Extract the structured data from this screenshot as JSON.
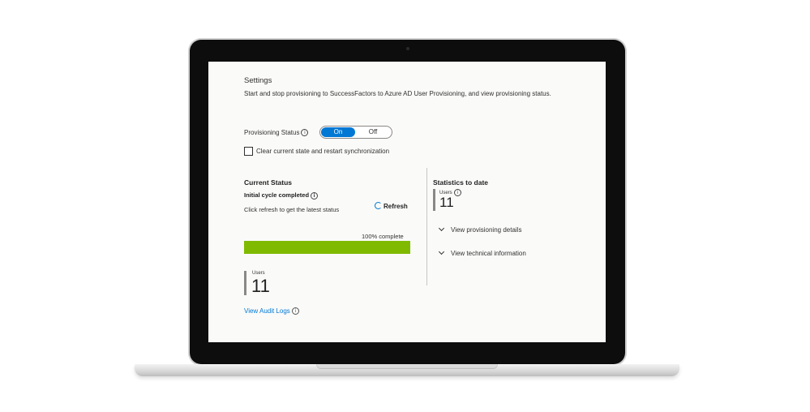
{
  "settings": {
    "title": "Settings",
    "description": "Start and stop provisioning to SuccessFactors to Azure AD User Provisioning, and view provisioning status."
  },
  "provisioning": {
    "label": "Provisioning Status",
    "toggle_on": "On",
    "toggle_off": "Off",
    "state": "On"
  },
  "clear_state": {
    "label": "Clear current state and restart synchronization",
    "checked": false
  },
  "current_status": {
    "title": "Current Status",
    "cycle": "Initial cycle completed",
    "hint": "Click refresh to get the latest status",
    "refresh_label": "Refresh",
    "progress_text": "100% complete",
    "progress_value": 100,
    "users_label": "Users",
    "users_count": "11",
    "audit_link": "View Audit Logs"
  },
  "statistics": {
    "title": "Statistics to date",
    "users_label": "Users",
    "users_count": "11",
    "expanders": [
      "View provisioning details",
      "View technical information"
    ]
  },
  "colors": {
    "accent": "#0078d4",
    "progress": "#7fba00"
  },
  "icons": {
    "info": "info-icon",
    "refresh": "refresh-icon",
    "chevron": "chevron-down-icon"
  }
}
